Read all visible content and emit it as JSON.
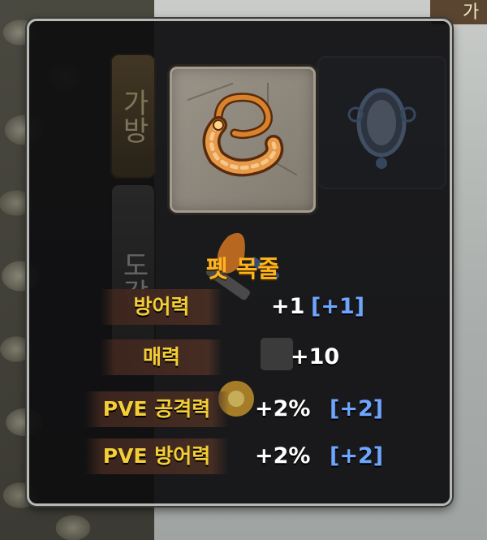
{
  "background": {
    "top_right_hint": "가"
  },
  "side_tabs": [
    {
      "label": "가방"
    },
    {
      "label": "도감"
    }
  ],
  "item": {
    "name": "펫 목줄",
    "icon": "leash-icon",
    "rarity_color": "#8c8579"
  },
  "stats": [
    {
      "label": "방어력",
      "value": "+1",
      "bonus": "[+1]"
    },
    {
      "label": "매력",
      "value": "+10",
      "bonus": ""
    },
    {
      "label": "PVE 공격력",
      "value": "+2%",
      "bonus": "[+2]"
    },
    {
      "label": "PVE 방어력",
      "value": "+2%",
      "bonus": "[+2]"
    }
  ],
  "colors": {
    "item_name": "#ffb31e",
    "stat_label": "#f4ce37",
    "stat_value": "#ffffff",
    "stat_bonus": "#6ea6ff"
  }
}
